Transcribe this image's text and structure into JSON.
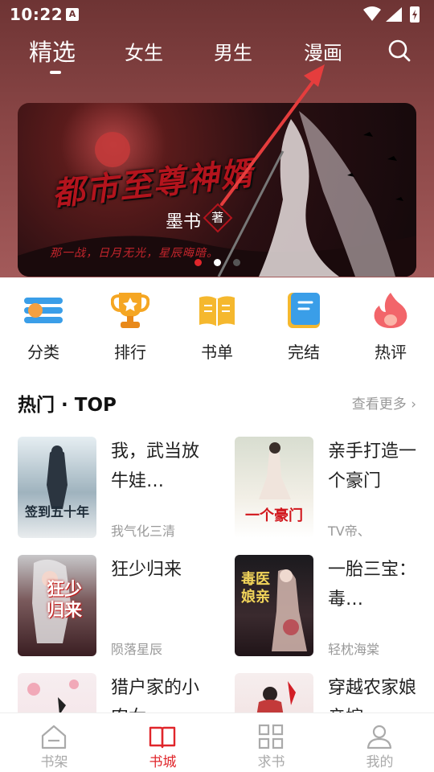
{
  "status_bar": {
    "time": "10:22",
    "notification_letter": "A"
  },
  "top_tabs": [
    {
      "label": "精选",
      "active": true
    },
    {
      "label": "女生",
      "active": false
    },
    {
      "label": "男生",
      "active": false
    },
    {
      "label": "漫画",
      "active": false
    }
  ],
  "banner": {
    "title": "都市至尊神婿",
    "author": "墨书",
    "author_badge": "著",
    "tagline": "那一战，日月无光，星辰晦暗。",
    "slide_count": 3,
    "active_slide": 1
  },
  "categories": [
    {
      "label": "分类",
      "icon": "category-list-icon",
      "color": "#3a9ee8"
    },
    {
      "label": "排行",
      "icon": "trophy-icon",
      "color": "#f5a623"
    },
    {
      "label": "书单",
      "icon": "open-book-icon",
      "color": "#f5b82e"
    },
    {
      "label": "完结",
      "icon": "finished-book-icon",
      "color": "#3a9ee8"
    },
    {
      "label": "热评",
      "icon": "flame-icon",
      "color": "#f2656a"
    }
  ],
  "hot_section": {
    "title": "热门 · TOP",
    "more_label": "查看更多"
  },
  "books": [
    {
      "title": "我，武当放牛娃…",
      "author": "我气化三清",
      "cover_text": "签到五十年"
    },
    {
      "title": "亲手打造一个豪门",
      "author": "TV帝、",
      "cover_text": "一个豪门"
    },
    {
      "title": "狂少归来",
      "author": "陨落星辰",
      "cover_text": "狂少归来"
    },
    {
      "title": "一胎三宝：毒…",
      "author": "轻枕海棠",
      "cover_text": "毒医娘亲"
    },
    {
      "title": "猎户家的小农女",
      "author": "",
      "cover_text": ""
    },
    {
      "title": "穿越农家娘亲嫁",
      "author": "",
      "cover_text": ""
    }
  ],
  "bottom_nav": [
    {
      "label": "书架",
      "icon": "bookshelf-icon",
      "active": false
    },
    {
      "label": "书城",
      "icon": "book-store-icon",
      "active": true
    },
    {
      "label": "求书",
      "icon": "request-grid-icon",
      "active": false
    },
    {
      "label": "我的",
      "icon": "profile-icon",
      "active": false
    }
  ],
  "colors": {
    "accent": "#e0262b",
    "header_top": "#6e3434",
    "header_bottom": "#a35a5a",
    "muted_text": "#999999"
  }
}
